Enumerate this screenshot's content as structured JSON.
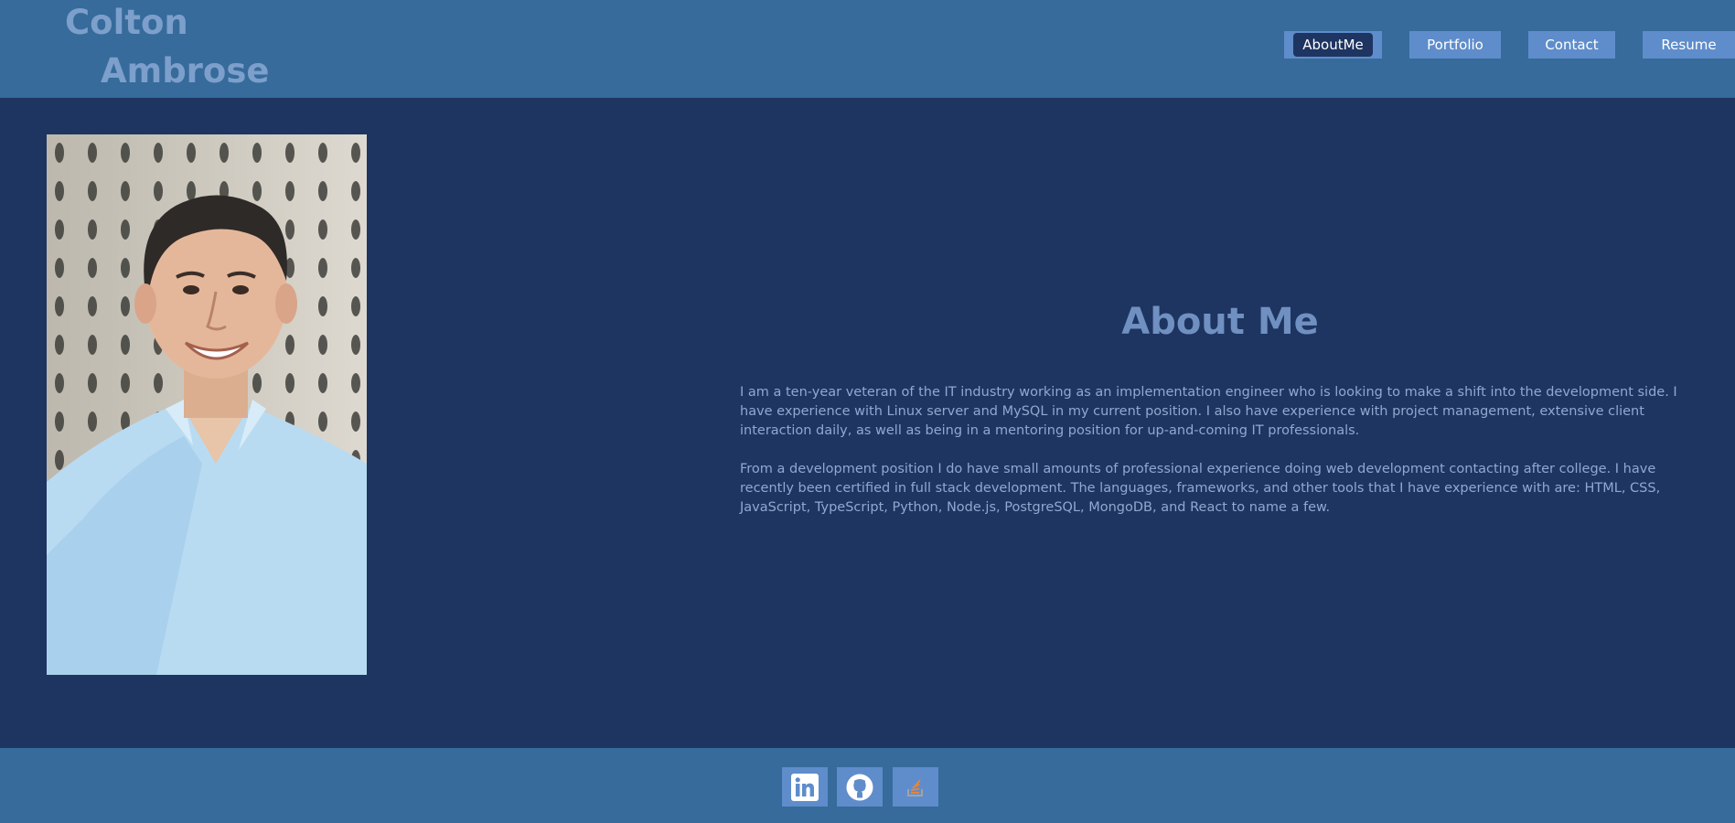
{
  "header": {
    "logo_first": "Colton",
    "logo_last": "Ambrose"
  },
  "nav": {
    "items": [
      {
        "label": "AboutMe",
        "active": true
      },
      {
        "label": "Portfolio",
        "active": false
      },
      {
        "label": "Contact",
        "active": false
      },
      {
        "label": "Resume",
        "active": false
      }
    ]
  },
  "about": {
    "title": "About Me",
    "paragraphs": [
      "I am a ten-year veteran of the IT industry working as an implementation engineer who is looking to make a shift into the development side. I have experience with Linux server and MySQL in my current position. I also have experience with project management, extensive client interaction daily, as well as being in a mentoring position for up-and-coming IT professionals.",
      "From a development position I do have small amounts of professional experience doing web development contacting after college. I have recently been certified in full stack development. The languages, frameworks, and other tools that I have experience with are: HTML, CSS, JavaScript, TypeScript, Python, Node.js, PostgreSQL, MongoDB, and React to name a few."
    ]
  },
  "footer": {
    "links": [
      {
        "icon": "linkedin-icon"
      },
      {
        "icon": "github-icon"
      },
      {
        "icon": "stackoverflow-icon"
      }
    ]
  },
  "colors": {
    "header_bg": "#366b9b",
    "page_bg": "#1e3461",
    "button_bg": "#5f8dcb",
    "logo_text": "#7d9fcb",
    "body_text": "#8fa9d0"
  }
}
